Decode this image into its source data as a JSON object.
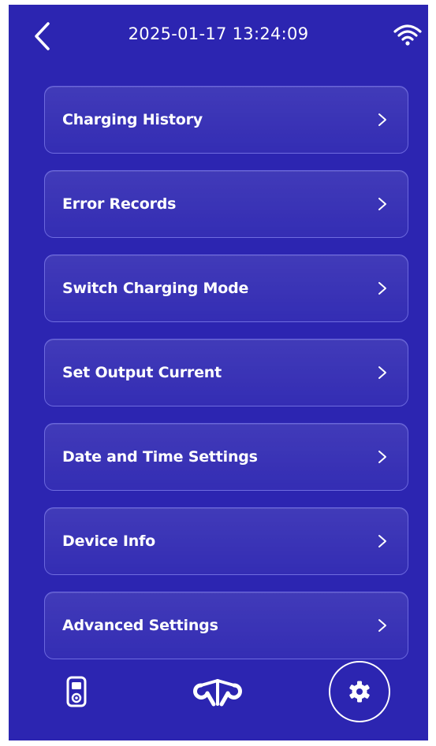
{
  "status_bar": {
    "datetime": "2025-01-17 13:24:09",
    "back_icon": "chevron-left-icon",
    "wifi_icon": "wifi-icon"
  },
  "menu": {
    "items": [
      {
        "label": "Charging History"
      },
      {
        "label": "Error Records"
      },
      {
        "label": "Switch Charging Mode"
      },
      {
        "label": "Set Output Current"
      },
      {
        "label": "Date and Time Settings"
      },
      {
        "label": "Device Info"
      },
      {
        "label": "Advanced Settings"
      }
    ],
    "chevron_icon": "chevron-right-icon"
  },
  "bottom_nav": {
    "items": [
      {
        "icon": "charger-icon",
        "active": false
      },
      {
        "icon": "brand-logo",
        "active": false
      },
      {
        "icon": "gear-icon",
        "active": true
      }
    ]
  },
  "colors": {
    "background": "#2c25b1",
    "card_border": "#9696ff",
    "text": "#ffffff"
  }
}
